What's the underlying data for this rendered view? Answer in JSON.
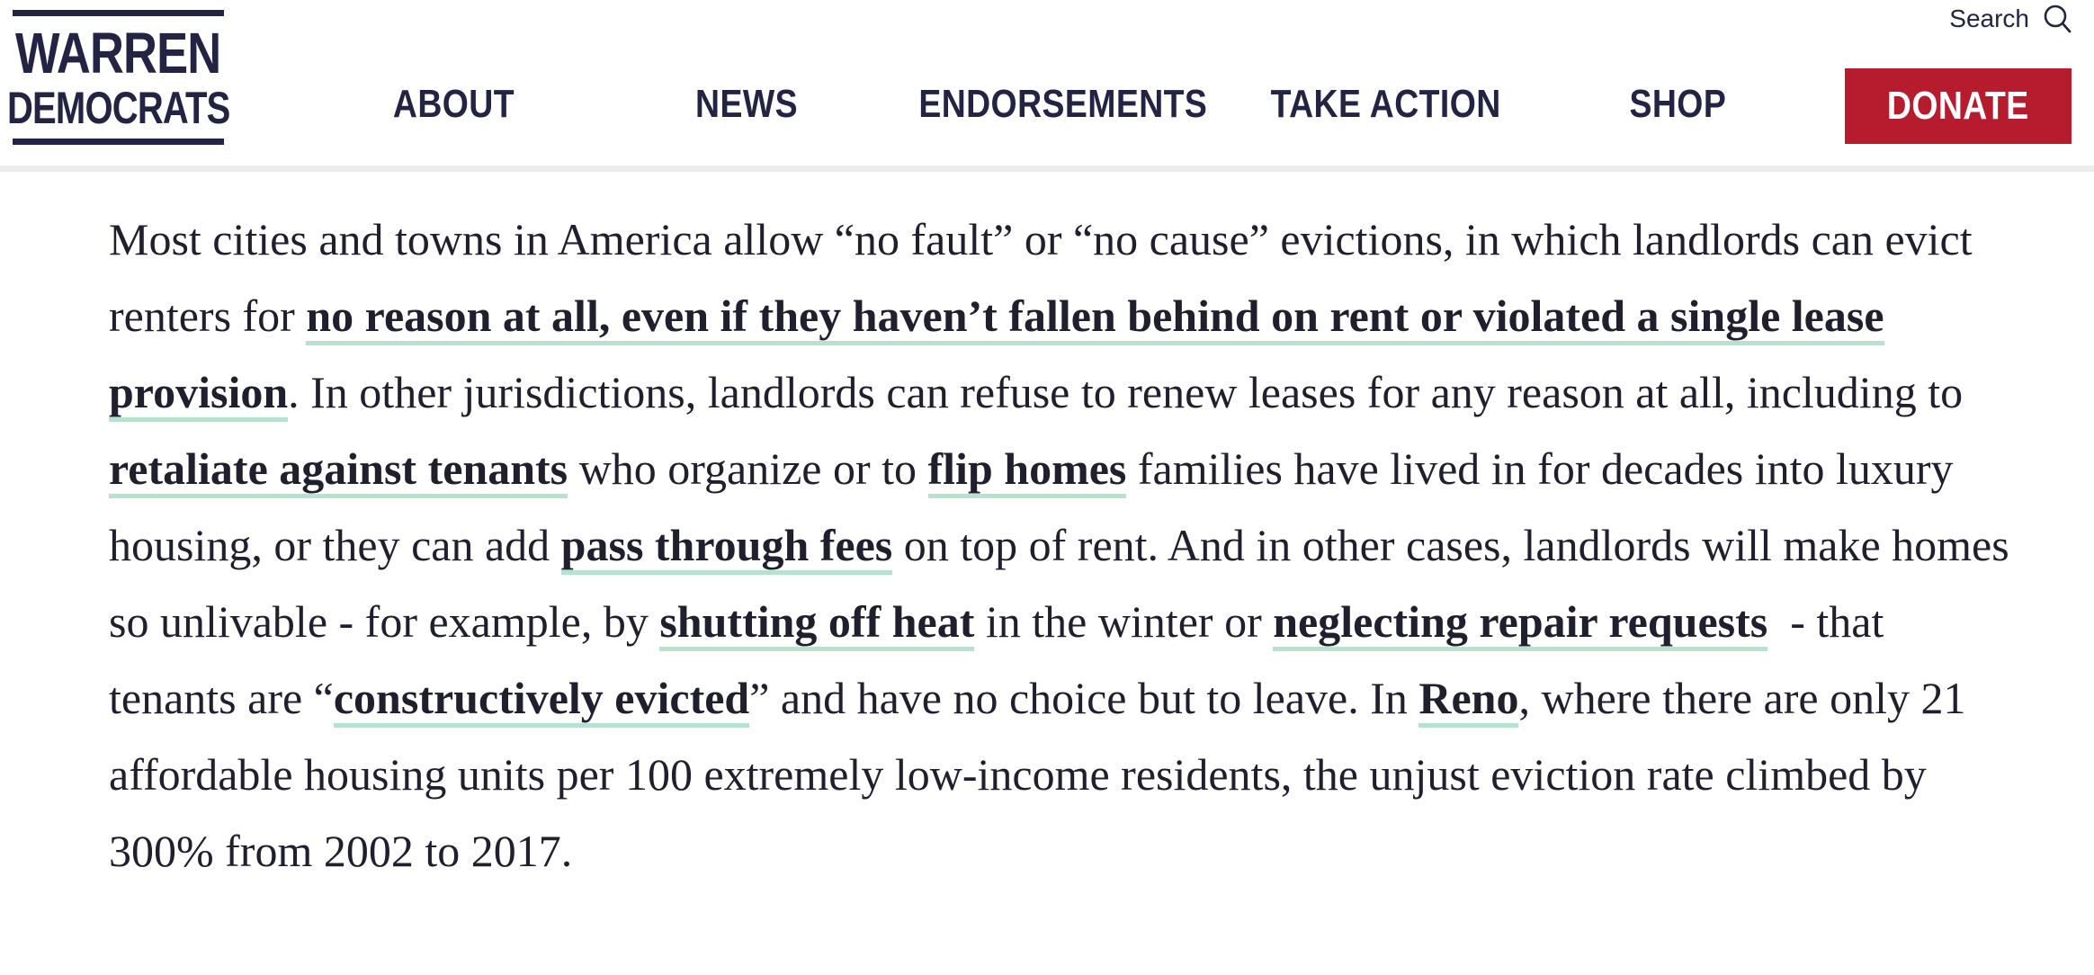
{
  "header": {
    "logo": {
      "line1": "WARREN",
      "line2": "DEMOCRATS"
    },
    "search": {
      "label": "Search",
      "icon": "search-icon"
    },
    "nav": {
      "about": "ABOUT",
      "news": "NEWS",
      "endorsements": "ENDORSEMENTS",
      "take_action": "TAKE ACTION",
      "shop": "SHOP"
    },
    "donate": "DONATE"
  },
  "colors": {
    "brand_navy": "#232444",
    "donate_red": "#b71c2e",
    "link_underline": "#b6e2d0"
  },
  "article": {
    "t1": "Most cities and towns in America allow “no fault” or “no cause” evictions, in which landlords can evict renters for ",
    "l1": "no reason at all, even if they haven’t fallen behind on rent or violated a single lease provision",
    "t2": ". In other jurisdictions, landlords can refuse to renew leases for any reason at all, including to ",
    "l2": "retaliate against tenants",
    "t3": " who organize or to ",
    "l3": "flip homes",
    "t4": " families have lived in for decades into luxury housing, or they can add ",
    "l4": "pass through fees",
    "t5": " on top of rent. And in other cases, landlords will make homes so unlivable - for example, by ",
    "l5": "shutting off heat",
    "t6": " in the winter or ",
    "l6": "neglecting repair requests",
    "t7": "  - that tenants are “",
    "l7": "constructively evicted",
    "t8": "” and have no choice but to leave. In ",
    "l8": "Reno",
    "t9": ", where there are only 21 affordable housing units per 100 extremely low-income residents, the unjust eviction rate climbed by 300% from 2002 to 2017."
  }
}
